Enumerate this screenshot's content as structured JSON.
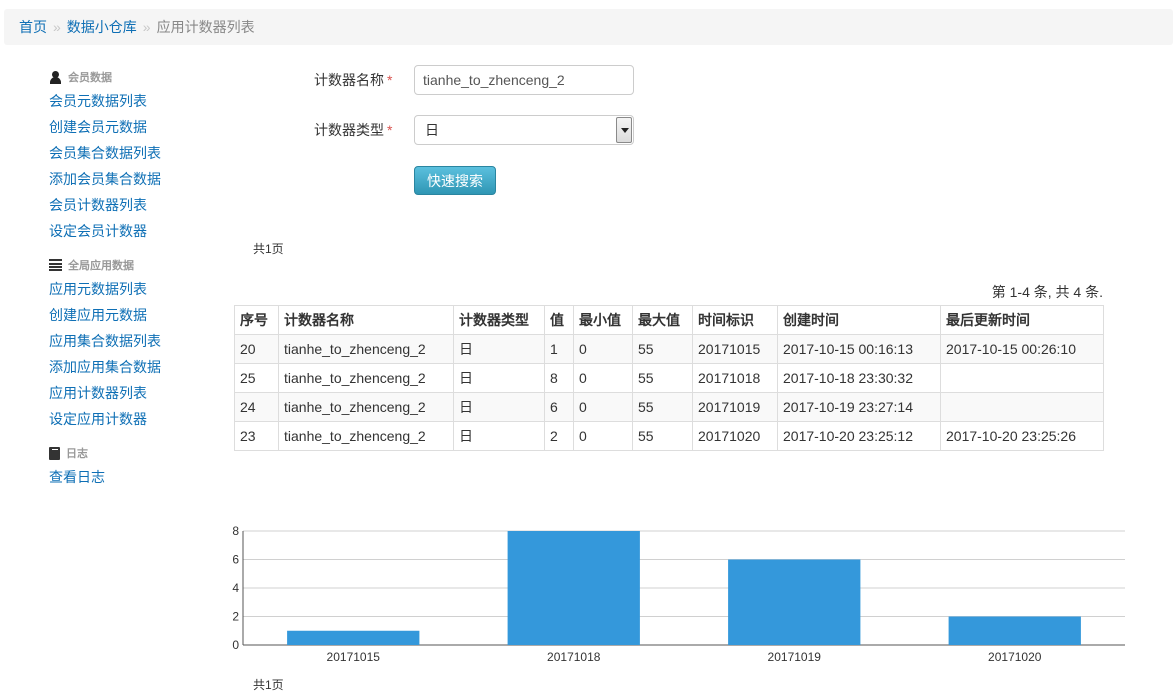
{
  "breadcrumb": {
    "home": "首页",
    "section": "数据小仓库",
    "current": "应用计数器列表",
    "sep": "»"
  },
  "sidebar": {
    "groups": [
      {
        "header": "会员数据",
        "icon": "user-icon",
        "items": [
          "会员元数据列表",
          "创建会员元数据",
          "会员集合数据列表",
          "添加会员集合数据",
          "会员计数器列表",
          "设定会员计数器"
        ]
      },
      {
        "header": "全局应用数据",
        "icon": "list-icon",
        "items": [
          "应用元数据列表",
          "创建应用元数据",
          "应用集合数据列表",
          "添加应用集合数据",
          "应用计数器列表",
          "设定应用计数器"
        ]
      },
      {
        "header": "日志",
        "icon": "book-icon",
        "items": [
          "查看日志"
        ]
      }
    ]
  },
  "form": {
    "name_label": "计数器名称",
    "name_value": "tianhe_to_zhenceng_2",
    "type_label": "计数器类型",
    "type_value": "日",
    "required_mark": "*",
    "search_button": "快速搜索"
  },
  "pagination": {
    "pages_text": "共1页",
    "summary": "第 1-4 条, 共 4 条."
  },
  "table": {
    "headers": [
      "序号",
      "计数器名称",
      "计数器类型",
      "值",
      "最小值",
      "最大值",
      "时间标识",
      "创建时间",
      "最后更新时间"
    ],
    "rows": [
      [
        "20",
        "tianhe_to_zhenceng_2",
        "日",
        "1",
        "0",
        "55",
        "20171015",
        "2017-10-15 00:16:13",
        "2017-10-15 00:26:10"
      ],
      [
        "25",
        "tianhe_to_zhenceng_2",
        "日",
        "8",
        "0",
        "55",
        "20171018",
        "2017-10-18 23:30:32",
        ""
      ],
      [
        "24",
        "tianhe_to_zhenceng_2",
        "日",
        "6",
        "0",
        "55",
        "20171019",
        "2017-10-19 23:27:14",
        ""
      ],
      [
        "23",
        "tianhe_to_zhenceng_2",
        "日",
        "2",
        "0",
        "55",
        "20171020",
        "2017-10-20 23:25:12",
        "2017-10-20 23:25:26"
      ]
    ]
  },
  "chart_data": {
    "type": "bar",
    "categories": [
      "20171015",
      "20171018",
      "20171019",
      "20171020"
    ],
    "values": [
      1,
      8,
      6,
      2
    ],
    "ylim": [
      0,
      8
    ],
    "yticks": [
      0,
      2,
      4,
      6,
      8
    ],
    "grid": true,
    "bar_color": "#3498db",
    "title": "",
    "xlabel": "",
    "ylabel": ""
  },
  "colors": {
    "link": "#0e6fb5",
    "button": "#49afcd",
    "bar": "#3498db",
    "required": "#d9534f"
  }
}
